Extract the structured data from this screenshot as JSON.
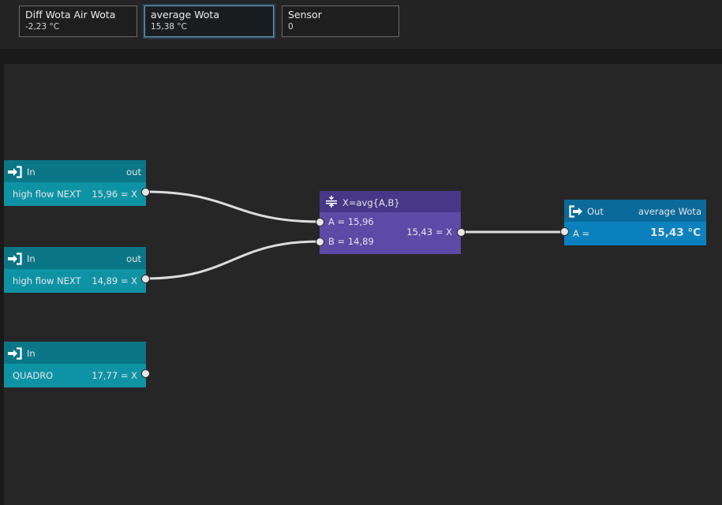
{
  "toolbar": {
    "tiles": [
      {
        "name": "Diff Wota Air Wota",
        "value": "-2,23 °C",
        "selected": false
      },
      {
        "name": "average Wota",
        "value": "15,38 °C",
        "selected": true
      },
      {
        "name": "Sensor",
        "value": "0",
        "selected": false
      }
    ]
  },
  "canvas": {
    "input_nodes": [
      {
        "header": "In",
        "out_label": "out",
        "sensor": "high flow NEXT",
        "value": "15,96 = X",
        "icon": "sign-in-icon"
      },
      {
        "header": "In",
        "out_label": "out",
        "sensor": "high flow NEXT",
        "value": "14,89 = X",
        "icon": "sign-in-icon"
      },
      {
        "header": "In",
        "out_label": "",
        "sensor": "QUADRO",
        "value": "17,77 = X",
        "icon": "sign-in-icon"
      }
    ],
    "function_node": {
      "title": "X=avg{A,B}",
      "icon": "average-icon",
      "input_a": "A = 15,96",
      "input_b": "B = 14,89",
      "output": "15,43 = X"
    },
    "output_node": {
      "header": "Out",
      "target": "average Wota",
      "input_label": "A =",
      "value": "15,43 °C",
      "icon": "sign-out-icon"
    }
  },
  "colors": {
    "input_node": "#0e93a5",
    "input_header": "#0b7686",
    "function_node": "#5b4aa6",
    "function_header": "#463887",
    "output_node": "#0b82bd",
    "output_header": "#0a6a9a",
    "wire": "#dcdcdc",
    "canvas": "#262626"
  }
}
